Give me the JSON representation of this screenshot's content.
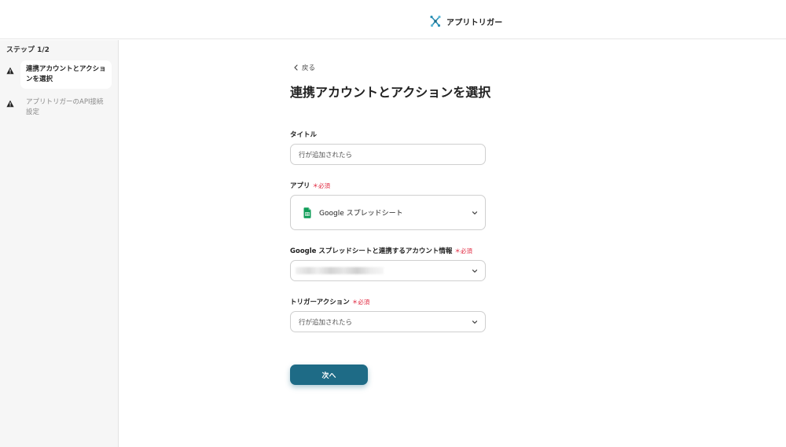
{
  "header": {
    "brand_name": "アプリトリガー",
    "brand_icon": "yoom-logo-icon",
    "brand_color": "#2a8fb5"
  },
  "sidebar": {
    "step_count": "ステップ 1/2",
    "steps": [
      {
        "label": "連携アカウントとアクションを選択",
        "status_icon": "warning-icon",
        "active": true
      },
      {
        "label": "アプリトリガーのAPI接続設定",
        "status_icon": "warning-icon",
        "active": false
      }
    ]
  },
  "main": {
    "back_label": "戻る",
    "title": "連携アカウントとアクションを選択",
    "fields": {
      "title": {
        "label": "タイトル",
        "value": "行が追加されたら"
      },
      "app": {
        "label": "アプリ",
        "required": "＊必須",
        "value": "Google スプレッドシート",
        "icon": "google-sheets-icon"
      },
      "account": {
        "label": "Google スプレッドシートと連携するアカウント情報",
        "required": "＊必須",
        "value": ""
      },
      "trigger_action": {
        "label": "トリガーアクション",
        "required": "＊必須",
        "value": "行が追加されたら"
      }
    },
    "next_button": "次へ"
  },
  "colors": {
    "primary_button": "#1e6b86",
    "required": "#e0243c",
    "sidebar_bg": "#f6f6f6",
    "warning": "#222222",
    "sheets_green": "#0f9d58"
  }
}
